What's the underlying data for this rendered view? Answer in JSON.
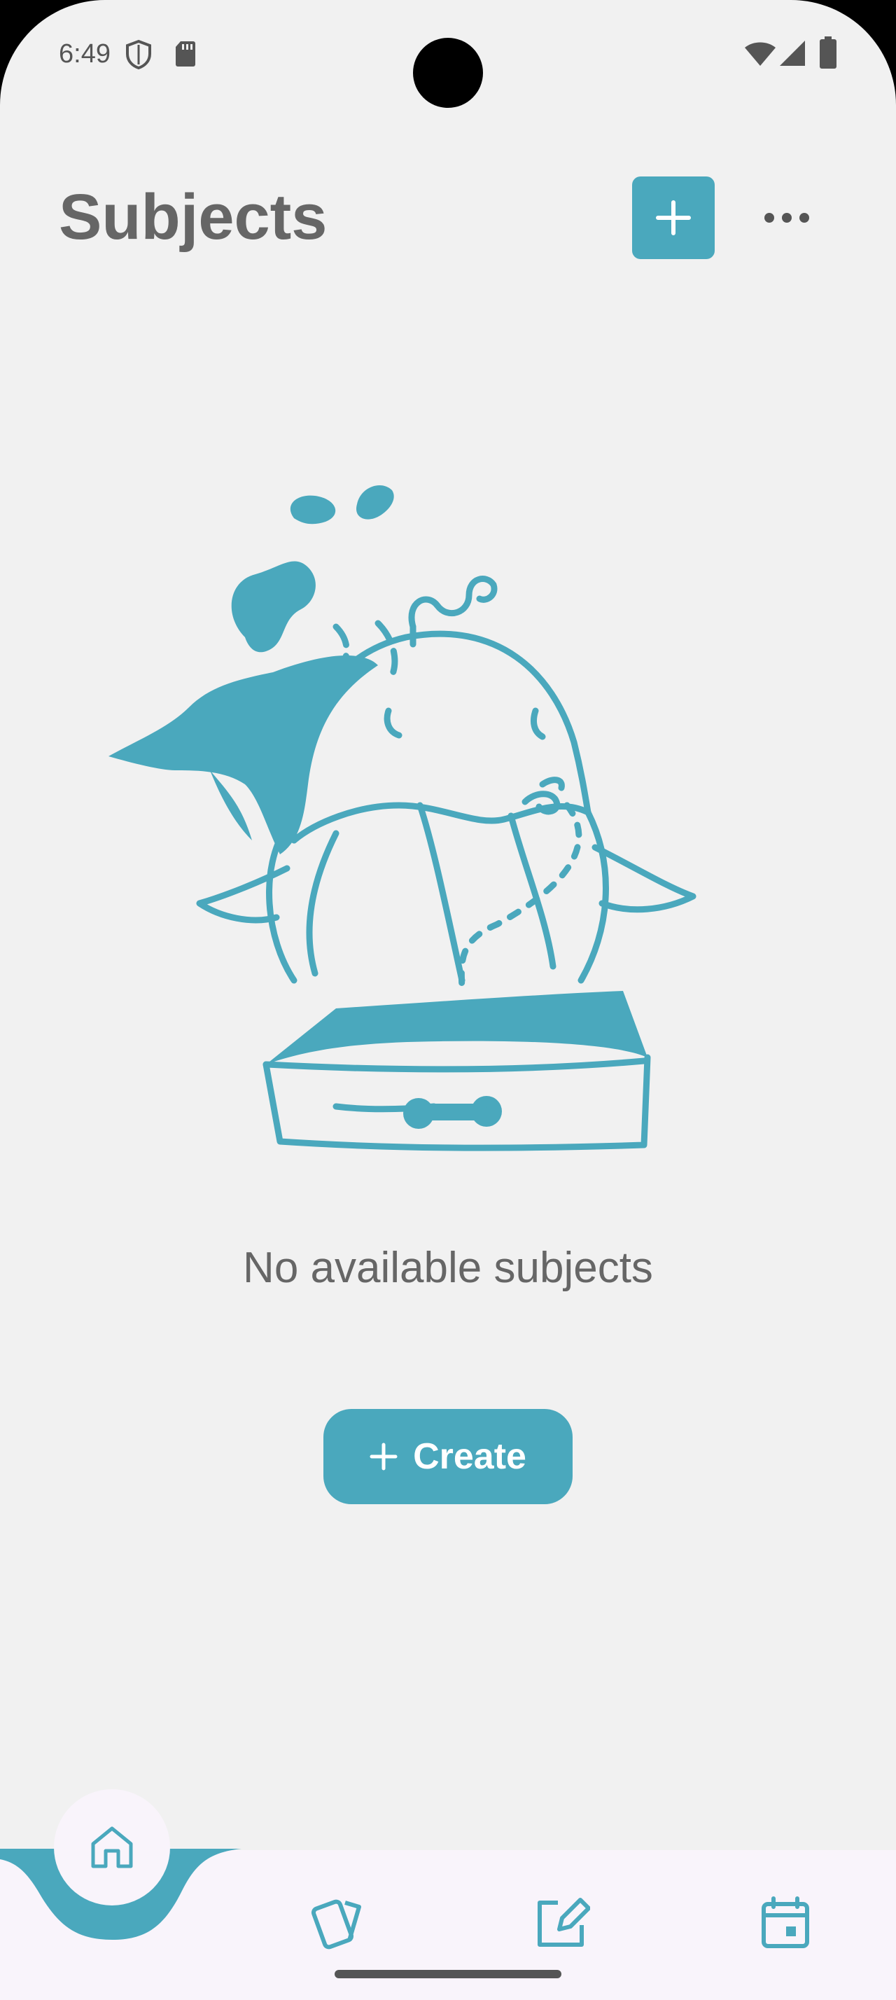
{
  "status_bar": {
    "time": "6:49",
    "icons": [
      "shield-icon",
      "sd-card-icon",
      "wifi-icon",
      "signal-icon",
      "battery-icon"
    ]
  },
  "header": {
    "title": "Subjects",
    "add_icon": "plus-icon",
    "menu_icon": "more-horizontal-icon"
  },
  "empty_state": {
    "illustration": "whale-in-drawer",
    "message": "No available subjects",
    "create_label": "Create",
    "create_icon": "plus-icon"
  },
  "bottom_nav": {
    "items": [
      {
        "icon": "home-icon",
        "active": true
      },
      {
        "icon": "flashcards-icon",
        "active": false
      },
      {
        "icon": "edit-note-icon",
        "active": false
      },
      {
        "icon": "calendar-icon",
        "active": false
      }
    ]
  },
  "colors": {
    "accent": "#4aa8bd",
    "background": "#f1f1f1",
    "nav_background": "#f9f4fb",
    "title_text": "#666666"
  }
}
